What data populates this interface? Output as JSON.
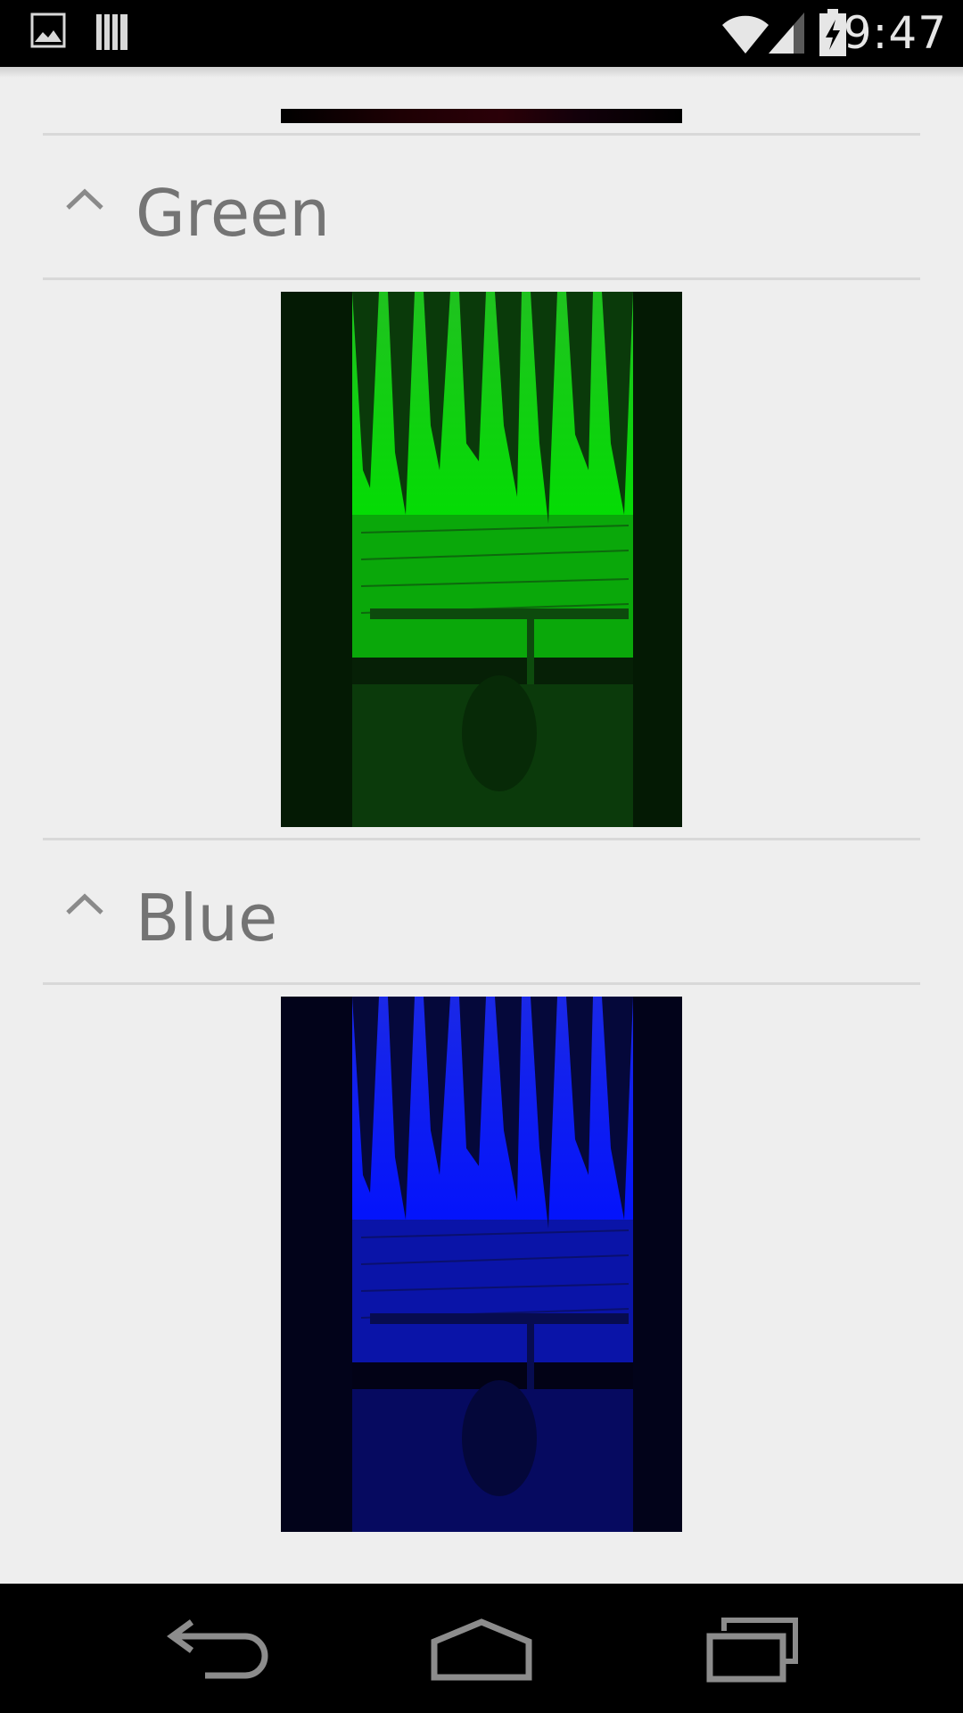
{
  "status_bar": {
    "time": "9:47",
    "left_icons": [
      "gallery-notification-icon",
      "bars-notification-icon"
    ],
    "right_icons": [
      "wifi-icon",
      "cell-signal-icon",
      "battery-charging-icon"
    ]
  },
  "sections": [
    {
      "title": "Green",
      "expanded": true,
      "tint": "#00d000"
    },
    {
      "title": "Blue",
      "expanded": true,
      "tint": "#0010ff"
    }
  ],
  "partial_section": {
    "tint": "#2b0008"
  },
  "nav_bar": {
    "buttons": [
      "back-icon",
      "home-icon",
      "recent-apps-icon"
    ]
  }
}
